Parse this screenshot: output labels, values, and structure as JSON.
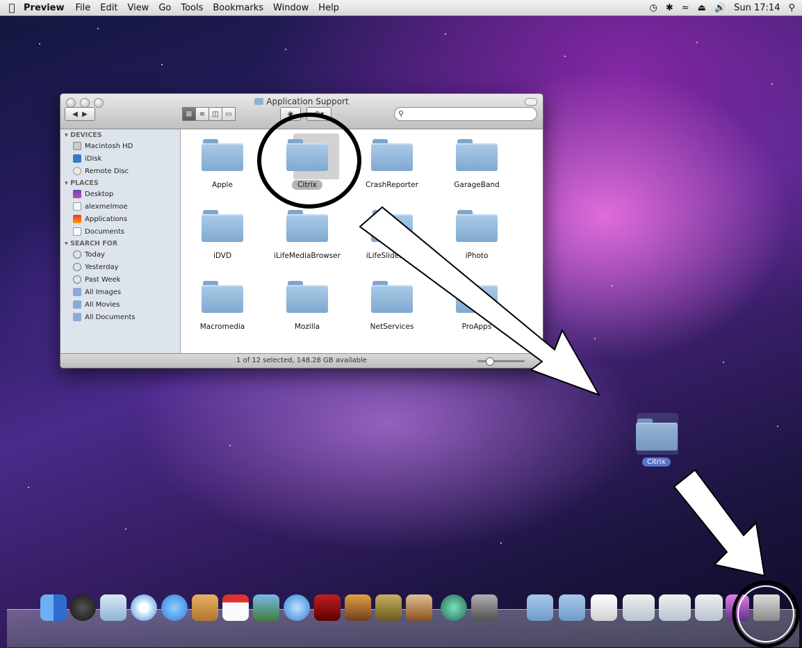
{
  "menubar": {
    "app_name": "Preview",
    "items": [
      "File",
      "Edit",
      "View",
      "Go",
      "Tools",
      "Bookmarks",
      "Window",
      "Help"
    ],
    "clock": "Sun 17:14"
  },
  "window": {
    "title": "Application Support",
    "sidebar": {
      "devices_header": "DEVICES",
      "devices": [
        "Macintosh HD",
        "iDisk",
        "Remote Disc"
      ],
      "places_header": "PLACES",
      "places": [
        "Desktop",
        "alexmelmoe",
        "Applications",
        "Documents"
      ],
      "search_header": "SEARCH FOR",
      "search": [
        "Today",
        "Yesterday",
        "Past Week",
        "All Images",
        "All Movies",
        "All Documents"
      ]
    },
    "folders": [
      "Apple",
      "Citrix",
      "CrashReporter",
      "GarageBand",
      "iDVD",
      "iLifeMediaBrowser",
      "iLifeSlideshow",
      "iPhoto",
      "Macromedia",
      "Mozilla",
      "NetServices",
      "ProApps"
    ],
    "selected_folder": "Citrix",
    "status": "1 of 12 selected, 148.28 GB available",
    "icon_size_slider": 0.2
  },
  "desktop": {
    "dragged_label": "Citrix"
  },
  "colors": {
    "folder": "#8fb4d9",
    "selection_badge": "#5a74c8"
  }
}
